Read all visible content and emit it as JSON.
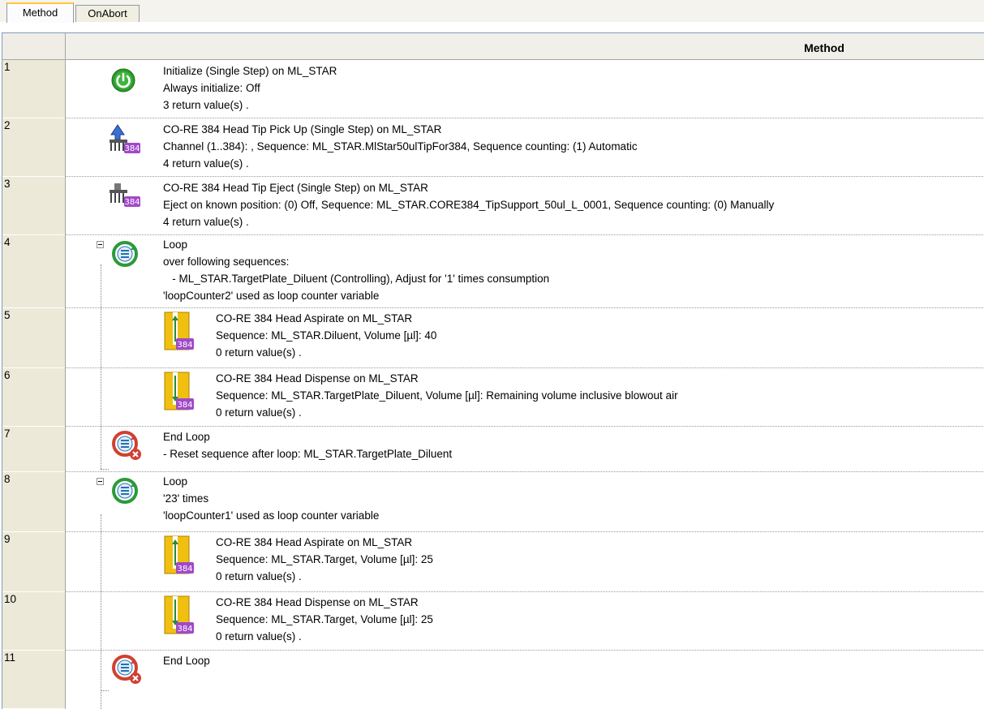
{
  "tabs": [
    {
      "label": "Method",
      "active": true
    },
    {
      "label": "OnAbort",
      "active": false
    }
  ],
  "grid": {
    "header_title": "Method"
  },
  "steps": [
    {
      "num": "1",
      "icon": "power-icon",
      "lines": [
        "Initialize (Single Step) on ML_STAR",
        "Always initialize: Off",
        "3 return value(s) ."
      ]
    },
    {
      "num": "2",
      "icon": "tip-pickup-384-icon",
      "lines": [
        "CO-RE 384 Head Tip Pick Up (Single Step) on ML_STAR",
        "Channel (1..384): , Sequence: ML_STAR.MlStar50ulTipFor384, Sequence counting: (1) Automatic",
        "4 return value(s) ."
      ]
    },
    {
      "num": "3",
      "icon": "tip-eject-384-icon",
      "lines": [
        "CO-RE 384 Head Tip Eject (Single Step) on ML_STAR",
        "Eject on known position: (0) Off, Sequence: ML_STAR.CORE384_TipSupport_50ul_L_0001, Sequence counting: (0) Manually",
        "4 return value(s) ."
      ]
    },
    {
      "num": "4",
      "icon": "loop-icon",
      "lines": [
        "Loop",
        "over following sequences:",
        "   - ML_STAR.TargetPlate_Diluent (Controlling), Adjust for '1' times consumption",
        "'loopCounter2' used as loop counter variable"
      ]
    },
    {
      "num": "5",
      "icon": "aspirate-384-icon",
      "lines": [
        "CO-RE 384 Head Aspirate on ML_STAR",
        "Sequence: ML_STAR.Diluent, Volume [µl]: 40",
        "0 return value(s) ."
      ]
    },
    {
      "num": "6",
      "icon": "dispense-384-icon",
      "lines": [
        "CO-RE 384 Head Dispense on ML_STAR",
        "Sequence: ML_STAR.TargetPlate_Diluent, Volume [µl]: Remaining volume inclusive blowout air",
        "0 return value(s) ."
      ]
    },
    {
      "num": "7",
      "icon": "end-loop-icon",
      "lines": [
        "End Loop",
        "- Reset sequence after loop: ML_STAR.TargetPlate_Diluent"
      ]
    },
    {
      "num": "8",
      "icon": "loop-icon",
      "lines": [
        "Loop",
        "'23' times",
        "'loopCounter1' used as loop counter variable"
      ]
    },
    {
      "num": "9",
      "icon": "aspirate-384-icon",
      "lines": [
        "CO-RE 384 Head Aspirate on ML_STAR",
        "Sequence: ML_STAR.Target, Volume [µl]: 25",
        "0 return value(s) ."
      ]
    },
    {
      "num": "10",
      "icon": "dispense-384-icon",
      "lines": [
        "CO-RE 384 Head Dispense on ML_STAR",
        "Sequence: ML_STAR.Target, Volume [µl]: 25",
        "0 return value(s) ."
      ]
    },
    {
      "num": "11",
      "icon": "end-loop-icon",
      "lines": [
        "End Loop"
      ]
    }
  ],
  "colors": {
    "power_green": "#2e9a2e",
    "loop_teal": "#1e8c6e",
    "badge_purple": "#a04ac8",
    "end_loop_red": "#d04030",
    "tube_yellow": "#f0c010"
  }
}
